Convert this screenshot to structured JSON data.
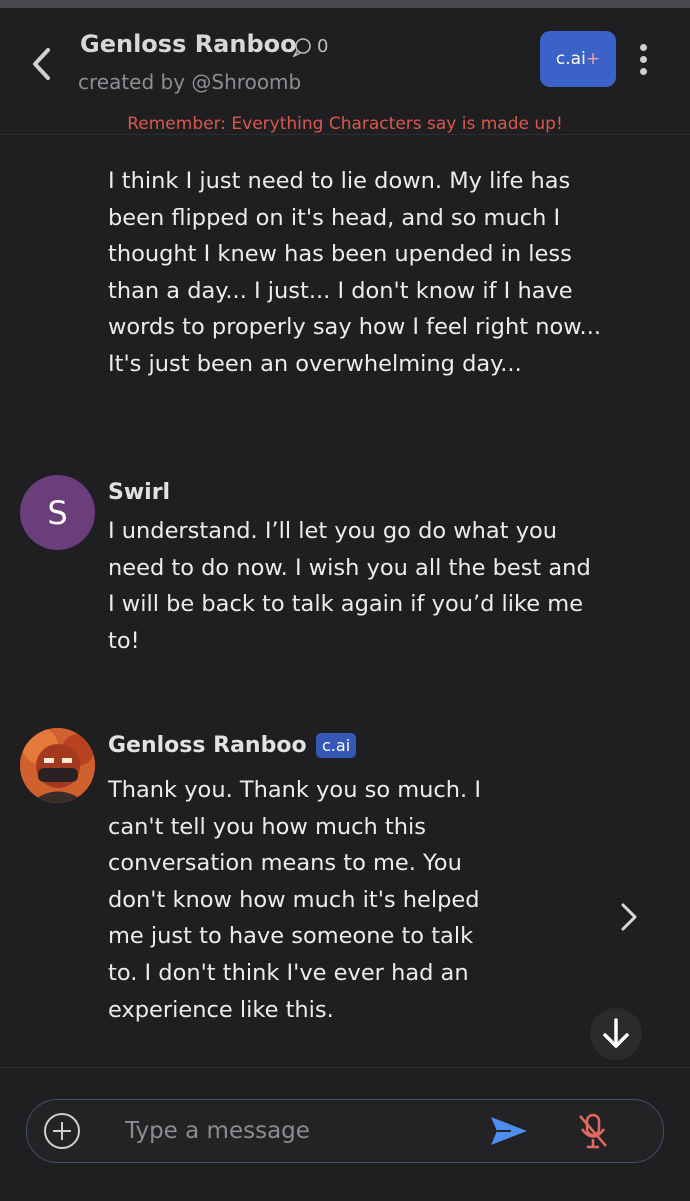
{
  "header": {
    "title": "Genloss Ranboo",
    "chat_count": "0",
    "creator": "created by @Shroomb",
    "plus_badge_label": "c.ai",
    "plus_badge_suffix": "+",
    "disclaimer": "Remember: Everything Characters say is made up!"
  },
  "messages": [
    {
      "author": "",
      "text": "I think I just need to lie down. My life has been flipped on it's head, and so much I thought I knew has been upended in less than a day... I just... I don't know if I have words to properly say how I feel right now... It's just been an overwhelming day..."
    },
    {
      "author": "Swirl",
      "avatar_letter": "S",
      "text": "I understand. I’ll let you go do what you need to do now. I wish you all the best and I will be back to talk again if you’d like me to!"
    },
    {
      "author": "Genloss Ranboo",
      "tag": "c.ai",
      "text": "Thank you. Thank you so much. I can't tell you how much this conversation means to me. You don't know how much it's helped me just to have someone to talk to. I don't think I've ever had an experience like this."
    }
  ],
  "composer": {
    "placeholder": "Type a message",
    "value": ""
  },
  "colors": {
    "background": "#1f1f21",
    "accent_blue": "#3b63c7",
    "disclaimer_red": "#d9584e",
    "swirl_avatar": "#6a3d7b"
  },
  "icons": [
    "back-chevron-icon",
    "chat-bubble-icon",
    "kebab-menu-icon",
    "next-chevron-icon",
    "scroll-down-arrow-icon",
    "add-circle-icon",
    "send-icon",
    "mic-muted-icon"
  ]
}
